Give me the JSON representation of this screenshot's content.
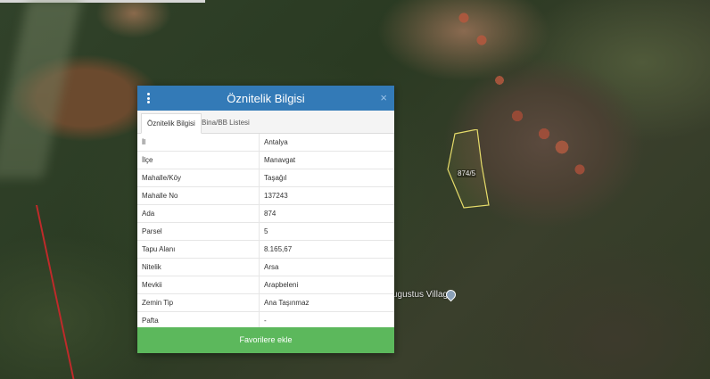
{
  "panel": {
    "title": "Öznitelik Bilgisi",
    "menu_icon": "vertical-ellipsis-icon",
    "close_label": "×",
    "tabs": [
      {
        "label": "Öznitelik Bilgisi",
        "active": true
      },
      {
        "label": "Bina/BB Listesi",
        "active": false
      }
    ],
    "rows": [
      {
        "key": "İl",
        "value": "Antalya"
      },
      {
        "key": "İlçe",
        "value": "Manavgat"
      },
      {
        "key": "Mahalle/Köy",
        "value": "Taşağıl"
      },
      {
        "key": "Mahalle No",
        "value": "137243"
      },
      {
        "key": "Ada",
        "value": "874"
      },
      {
        "key": "Parsel",
        "value": "5"
      },
      {
        "key": "Tapu Alanı",
        "value": "8.165,67"
      },
      {
        "key": "Nitelik",
        "value": "Arsa"
      },
      {
        "key": "Mevkii",
        "value": "Arapbeleni"
      },
      {
        "key": "Zemin Tip",
        "value": "Ana Taşınmaz"
      },
      {
        "key": "Pafta",
        "value": "-"
      }
    ],
    "favorite_button": "Favorilere ekle"
  },
  "map": {
    "parcel_label": "874/5",
    "place_label": "ugustus Village",
    "place_pin_icon": "location-pin-icon"
  },
  "colors": {
    "header": "#337ab7",
    "favorite_button": "#5cb85c",
    "parcel_outline": "#e6dc6a"
  }
}
